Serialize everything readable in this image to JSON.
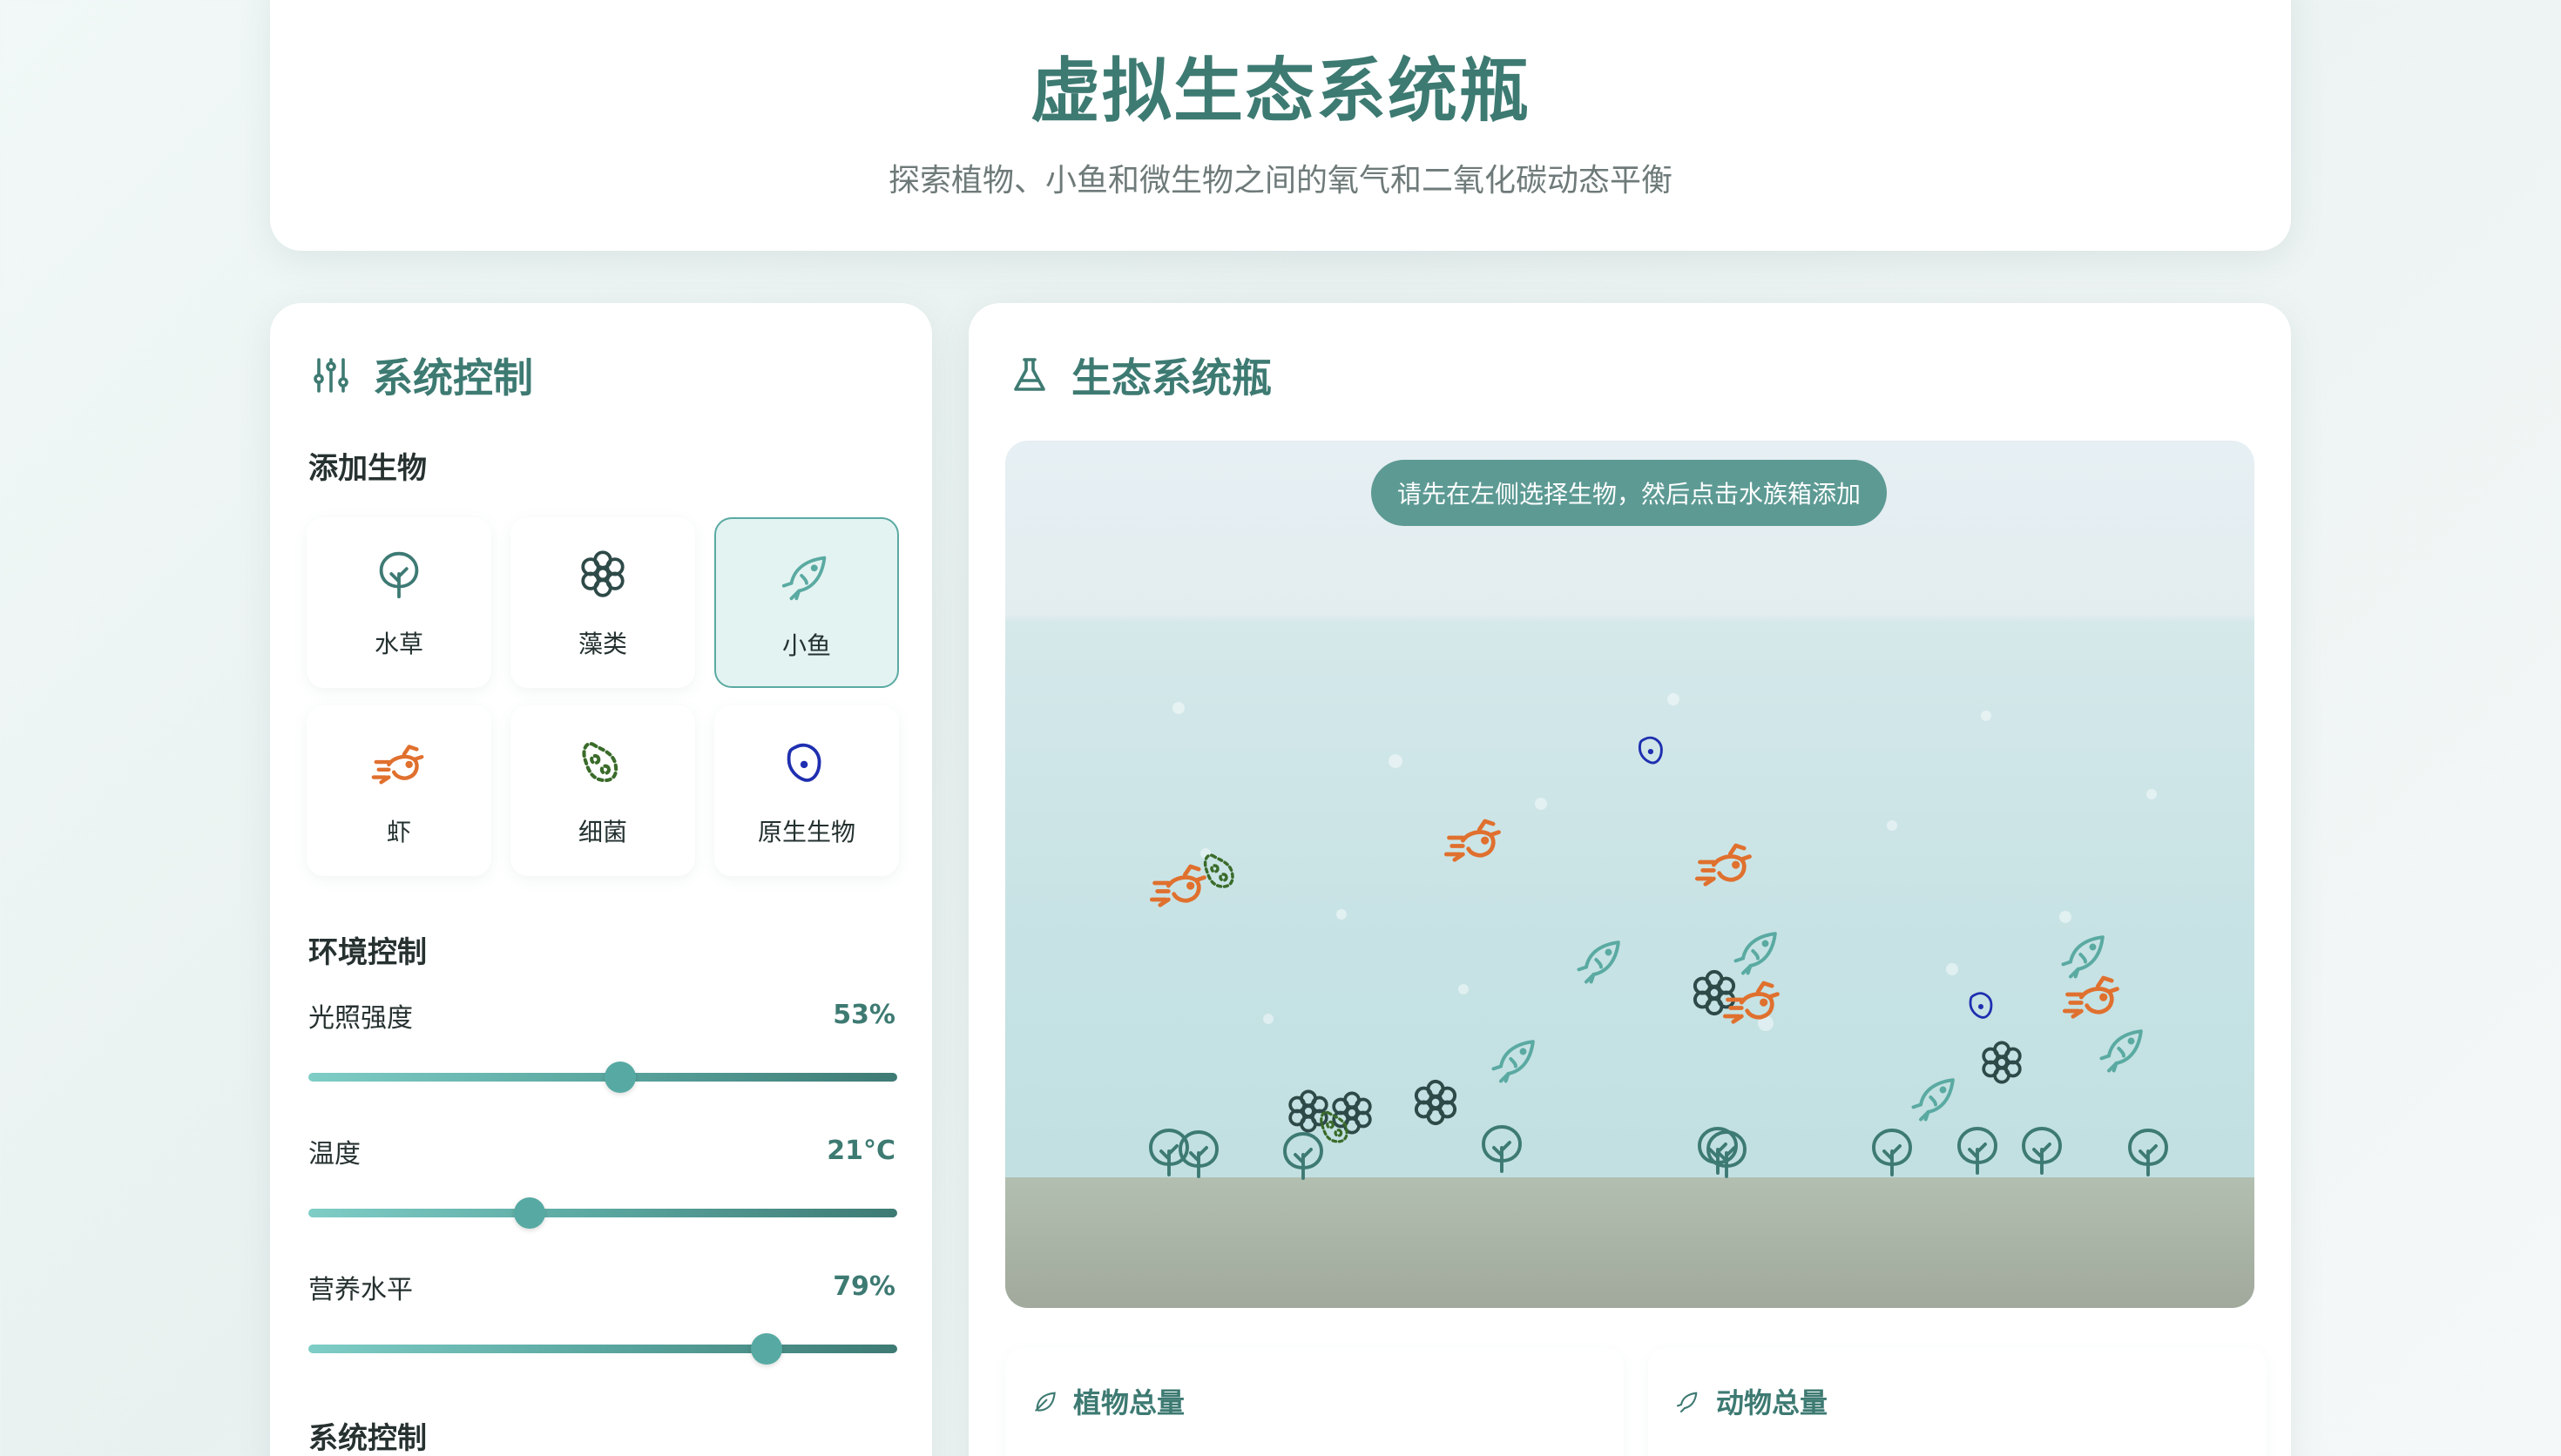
{
  "header": {
    "title": "虚拟生态系统瓶",
    "subtitle": "探索植物、小鱼和微生物之间的氧气和二氧化碳动态平衡"
  },
  "controls": {
    "title": "系统控制",
    "icon": "sliders-icon",
    "add_section": "添加生物",
    "organisms": [
      {
        "label": "水草",
        "icon": "plant-icon",
        "color": "#3e7a74",
        "selected": false
      },
      {
        "label": "藻类",
        "icon": "flower-icon",
        "color": "#2e4a48",
        "selected": false
      },
      {
        "label": "小鱼",
        "icon": "fish-icon",
        "color": "#5aaaa2",
        "selected": true
      },
      {
        "label": "虾",
        "icon": "shrimp-icon",
        "color": "#e0702e",
        "selected": false
      },
      {
        "label": "细菌",
        "icon": "bacteria-icon",
        "color": "#3a6b2a",
        "selected": false
      },
      {
        "label": "原生生物",
        "icon": "protozoa-icon",
        "color": "#1f2fb0",
        "selected": false
      }
    ],
    "env_section": "环境控制",
    "sliders": [
      {
        "label": "光照强度",
        "value_text": "53%",
        "value": 0.53
      },
      {
        "label": "温度",
        "value_text": "21°C",
        "value": 0.375
      },
      {
        "label": "营养水平",
        "value_text": "79%",
        "value": 0.778
      }
    ],
    "system_section": "系统控制"
  },
  "ecosystem": {
    "title": "生态系统瓶",
    "icon": "flask-icon",
    "hint": "请先在左侧选择生物，然后点击水族箱添加",
    "stats": [
      {
        "label": "植物总量",
        "icon": "leaf-icon"
      },
      {
        "label": "动物总量",
        "icon": "fish-icon"
      }
    ]
  }
}
